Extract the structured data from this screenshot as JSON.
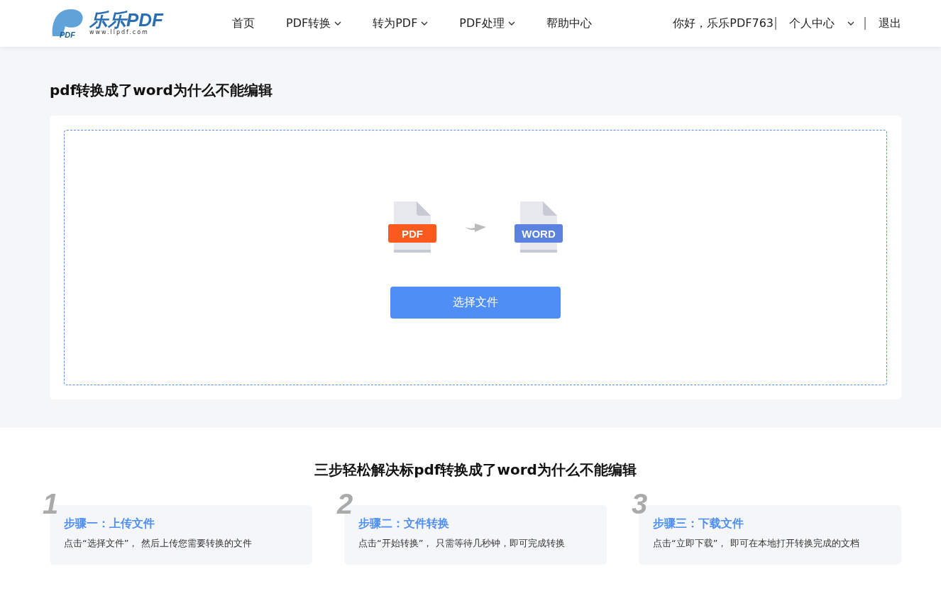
{
  "header": {
    "logo": {
      "mark": "PDF",
      "name": "乐乐PDF",
      "url": "www.llpdf.com"
    },
    "nav": [
      {
        "label": "首页",
        "dropdown": false
      },
      {
        "label": "PDF转换",
        "dropdown": true
      },
      {
        "label": "转为PDF",
        "dropdown": true
      },
      {
        "label": "PDF处理",
        "dropdown": true
      },
      {
        "label": "帮助中心",
        "dropdown": false
      }
    ],
    "greeting": "你好，乐乐PDF763",
    "account": "个人中心",
    "logout": "退出"
  },
  "title": "pdf转换成了word为什么不能编辑",
  "upload": {
    "from_label": "PDF",
    "to_label": "WORD",
    "button": "选择文件"
  },
  "steps_heading": "三步轻松解决标pdf转换成了word为什么不能编辑",
  "steps": [
    {
      "number": "1",
      "title": "步骤一：上传文件",
      "text": "点击“选择文件”， 然后上传您需要转换的文件"
    },
    {
      "number": "2",
      "title": "步骤二：文件转换",
      "text": "点击“开始转换”， 只需等待几秒钟，即可完成转换"
    },
    {
      "number": "3",
      "title": "步骤三：下载文件",
      "text": "点击“立即下载”， 即可在本地打开转换完成的文档"
    }
  ]
}
